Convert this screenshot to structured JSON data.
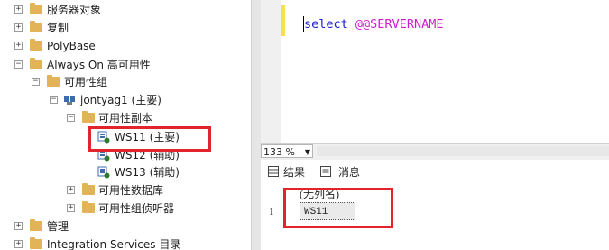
{
  "object_explorer": {
    "nodes": [
      {
        "label": "服务器对象",
        "expander": "+"
      },
      {
        "label": "复制",
        "expander": "+"
      },
      {
        "label": "PolyBase",
        "expander": "+"
      },
      {
        "label": "Always On 高可用性",
        "expander": "−"
      },
      {
        "label": "可用性组",
        "expander": "−"
      },
      {
        "label": "jontyag1 (主要)",
        "expander": "−"
      },
      {
        "label": "可用性副本",
        "expander": "−"
      },
      {
        "label": "WS11 (主要)"
      },
      {
        "label": "WS12 (辅助)"
      },
      {
        "label": "WS13 (辅助)"
      },
      {
        "label": "可用性数据库",
        "expander": "+"
      },
      {
        "label": "可用性组侦听器",
        "expander": "+"
      },
      {
        "label": "管理",
        "expander": "+"
      },
      {
        "label": "Integration Services 目录",
        "expander": "+"
      }
    ]
  },
  "editor": {
    "keyword": "select",
    "function": "@@SERVERNAME"
  },
  "zoom": {
    "value": "133 %"
  },
  "results_tabs": {
    "results_label": "结果",
    "messages_label": "消息"
  },
  "results_grid": {
    "column_header": "(无列名)",
    "rows": [
      {
        "number": "1",
        "value": "WS11"
      }
    ]
  },
  "colors": {
    "highlight_box": "#e3242b",
    "folder": "#e2b457",
    "keyword": "#1c1cd0",
    "function": "#ce1fce",
    "gutter_marker": "#f7e14b"
  }
}
